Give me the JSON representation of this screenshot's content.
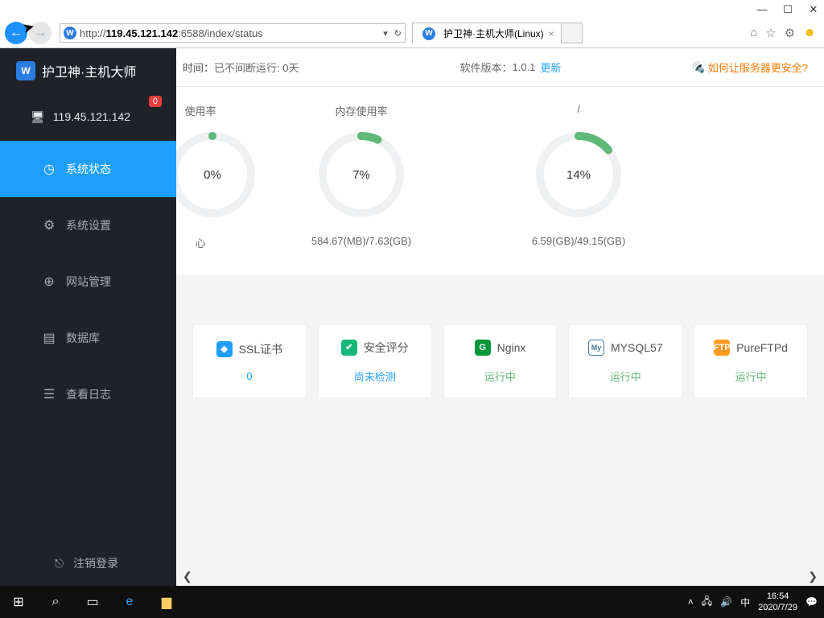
{
  "window": {
    "minimize": "—",
    "maximize": "☐",
    "close": "✕"
  },
  "browser": {
    "url_prefix": "http://",
    "url_host": "119.45.121.142",
    "url_rest": ":6588/index/status",
    "tab_title": "护卫神·主机大师(Linux)",
    "tab_close": "×",
    "icons": {
      "home": "⌂",
      "star": "☆",
      "gear": "⚙",
      "smiley": "☻"
    }
  },
  "sidebar": {
    "brand": "护卫神·主机大师",
    "brand_badge": "W",
    "ip": "119.45.121.142",
    "badge": "0",
    "items": [
      {
        "icon": "◷",
        "label": "系统状态"
      },
      {
        "icon": "⚙",
        "label": "系统设置"
      },
      {
        "icon": "⊕",
        "label": "网站管理"
      },
      {
        "icon": "▤",
        "label": "数据库"
      },
      {
        "icon": "☰",
        "label": "查看日志"
      }
    ],
    "logout_icon": "⎋",
    "logout": "注销登录"
  },
  "top": {
    "uptime_label": "时间：",
    "uptime_value": "已不间断运行: 0天",
    "version_label": "软件版本：",
    "version_value": "1.0.1",
    "update": "更新",
    "secure": "如何让服务器更安全?"
  },
  "chart_data": [
    {
      "type": "pie",
      "title": "使用率",
      "value_label": "0%",
      "percent": 0,
      "footer": "心"
    },
    {
      "type": "pie",
      "title": "内存使用率",
      "value_label": "7%",
      "percent": 7,
      "footer": "584.67(MB)/7.63(GB)"
    },
    {
      "type": "pie",
      "title": "/",
      "value_label": "14%",
      "percent": 14,
      "footer": "6.59(GB)/49.15(GB)"
    }
  ],
  "cards": [
    {
      "icon_bg": "ci-blue",
      "icon": "◆",
      "name": "SSL证书",
      "status": "0",
      "status_cls": "blue"
    },
    {
      "icon_bg": "ci-green",
      "icon": "✔",
      "name": "安全评分",
      "status": "尚未检测",
      "status_cls": "blue"
    },
    {
      "icon_bg": "ci-ngx",
      "icon": "G",
      "name": "Nginx",
      "status": "运行中",
      "status_cls": "green"
    },
    {
      "icon_bg": "ci-mysql",
      "icon": "My",
      "name": "MYSQL57",
      "status": "运行中",
      "status_cls": "green"
    },
    {
      "icon_bg": "ci-ftp",
      "icon": "FTP",
      "name": "PureFTPd",
      "status": "运行中",
      "status_cls": "green"
    }
  ],
  "scroll": {
    "left": "❮",
    "right": "❯"
  },
  "taskbar": {
    "time": "16:54",
    "date": "2020/7/29",
    "ime": "中"
  }
}
